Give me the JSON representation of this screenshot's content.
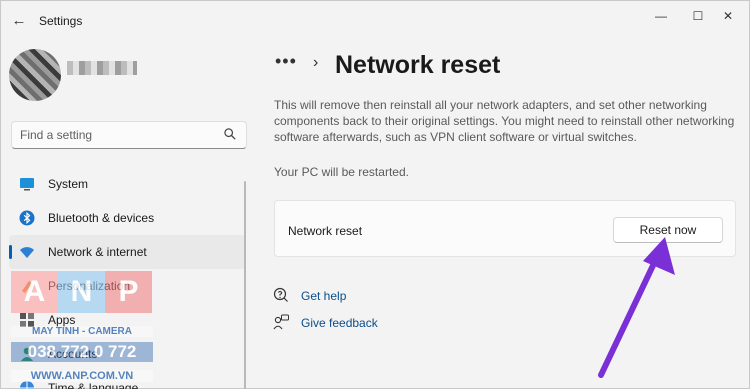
{
  "titlebar": {
    "app_title": "Settings",
    "back_icon": "←",
    "minimize_icon": "—",
    "maximize_icon": "☐",
    "close_icon": "✕"
  },
  "sidebar": {
    "search_placeholder": "Find a setting",
    "items": [
      {
        "label": "System",
        "icon": "monitor-icon",
        "active": false
      },
      {
        "label": "Bluetooth & devices",
        "icon": "bluetooth-icon",
        "active": false
      },
      {
        "label": "Network & internet",
        "icon": "wifi-icon",
        "active": true
      },
      {
        "label": "Personalization",
        "icon": "brush-icon",
        "active": false
      },
      {
        "label": "Apps",
        "icon": "apps-icon",
        "active": false
      },
      {
        "label": "Accounts",
        "icon": "person-icon",
        "active": false
      },
      {
        "label": "Time & language",
        "icon": "globe-icon",
        "active": false
      }
    ]
  },
  "main": {
    "breadcrumb_more": "•••",
    "breadcrumb_sep": "›",
    "title": "Network reset",
    "description": "This will remove then reinstall all your network adapters, and set other networking components back to their original settings. You might need to reinstall other networking software afterwards, such as VPN client software or virtual switches.",
    "restart_note": "Your PC will be restarted.",
    "card": {
      "label": "Network reset",
      "button": "Reset now"
    },
    "links": [
      {
        "label": "Get help",
        "icon": "help-icon"
      },
      {
        "label": "Give feedback",
        "icon": "feedback-icon"
      }
    ]
  },
  "watermark": {
    "letters": [
      "A",
      "N",
      "P"
    ],
    "tagline": "MAY TINH - CAMERA",
    "phone": "038 772 0 772",
    "site": "WWW.ANP.COM.VN"
  },
  "colors": {
    "accent": "#005fb8",
    "arrow": "#7b2fd6",
    "link": "#0a4d8c"
  }
}
